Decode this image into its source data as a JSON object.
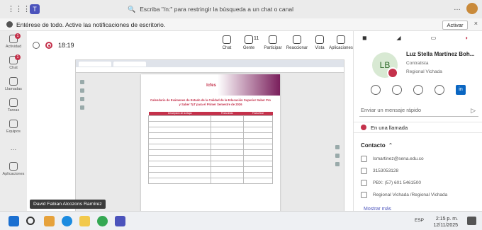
{
  "title_bar": {
    "search_placeholder": "Escriba \"/n:\" para restringir la búsqueda a un chat o canal",
    "more": "…"
  },
  "notification": {
    "text": "Entérese de todo. Active las notificaciones de escritorio.",
    "button": "Activar",
    "close": "×"
  },
  "rail": {
    "items": [
      {
        "label": "Actividad",
        "badge": "1"
      },
      {
        "label": "Chat",
        "badge": "1"
      },
      {
        "label": "Llamadas",
        "badge": ""
      },
      {
        "label": "Tareas",
        "badge": ""
      },
      {
        "label": "Equipos",
        "badge": ""
      },
      {
        "label": "…",
        "badge": ""
      },
      {
        "label": "Aplicaciones",
        "badge": ""
      }
    ]
  },
  "call": {
    "timer": "18:19",
    "buttons": [
      {
        "label": "Chat"
      },
      {
        "label": "Gente",
        "count": "11"
      },
      {
        "label": "Participar"
      },
      {
        "label": "Reaccionar"
      },
      {
        "label": "Vista"
      },
      {
        "label": "Aplicaciones"
      }
    ],
    "more": "…"
  },
  "shared_screen": {
    "doc_logo": "Icfes",
    "doc_title": "Calendario de Exámenes de Estado de la Calidad de la Educación Superior Saber Pro y Saber TyT para el Primer Semestre de 2026",
    "table_headers": [
      "Descripción de la etapa",
      "Fecha inicio",
      "Fecha final"
    ]
  },
  "presenter": {
    "name": "David Fabian Alcozons Ramírez"
  },
  "profile": {
    "initials": "LB",
    "name": "Luz Stella Martínez Boh...",
    "role": "Contratista",
    "org": "Regional Vichada",
    "message_placeholder": "Enviar un mensaje rápido",
    "status": "En una llamada",
    "contact_header": "Contacto",
    "contact": [
      {
        "icon": "mail-icon",
        "value": "lsmartinez@sena.edu.co"
      },
      {
        "icon": "phone-icon",
        "value": "3153053128"
      },
      {
        "icon": "call-icon",
        "value": "PBX: (57) 601 5461500"
      },
      {
        "icon": "location-icon",
        "value": "Regional Vichada /Regional Vichada"
      }
    ],
    "more": "Mostrar más"
  },
  "taskbar": {
    "lang": "ESP",
    "time": "2:15 p. m.",
    "date": "12/11/2025"
  }
}
